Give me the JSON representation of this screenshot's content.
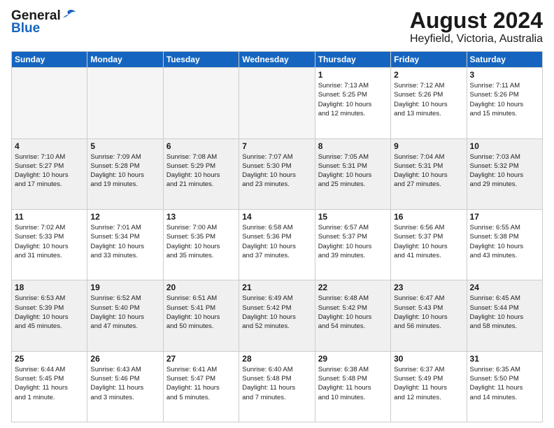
{
  "logo": {
    "general": "General",
    "blue": "Blue"
  },
  "title": "August 2024",
  "subtitle": "Heyfield, Victoria, Australia",
  "days_header": [
    "Sunday",
    "Monday",
    "Tuesday",
    "Wednesday",
    "Thursday",
    "Friday",
    "Saturday"
  ],
  "weeks": [
    [
      {
        "day": "",
        "info": ""
      },
      {
        "day": "",
        "info": ""
      },
      {
        "day": "",
        "info": ""
      },
      {
        "day": "",
        "info": ""
      },
      {
        "day": "1",
        "info": "Sunrise: 7:13 AM\nSunset: 5:25 PM\nDaylight: 10 hours\nand 12 minutes."
      },
      {
        "day": "2",
        "info": "Sunrise: 7:12 AM\nSunset: 5:26 PM\nDaylight: 10 hours\nand 13 minutes."
      },
      {
        "day": "3",
        "info": "Sunrise: 7:11 AM\nSunset: 5:26 PM\nDaylight: 10 hours\nand 15 minutes."
      }
    ],
    [
      {
        "day": "4",
        "info": "Sunrise: 7:10 AM\nSunset: 5:27 PM\nDaylight: 10 hours\nand 17 minutes."
      },
      {
        "day": "5",
        "info": "Sunrise: 7:09 AM\nSunset: 5:28 PM\nDaylight: 10 hours\nand 19 minutes."
      },
      {
        "day": "6",
        "info": "Sunrise: 7:08 AM\nSunset: 5:29 PM\nDaylight: 10 hours\nand 21 minutes."
      },
      {
        "day": "7",
        "info": "Sunrise: 7:07 AM\nSunset: 5:30 PM\nDaylight: 10 hours\nand 23 minutes."
      },
      {
        "day": "8",
        "info": "Sunrise: 7:05 AM\nSunset: 5:31 PM\nDaylight: 10 hours\nand 25 minutes."
      },
      {
        "day": "9",
        "info": "Sunrise: 7:04 AM\nSunset: 5:31 PM\nDaylight: 10 hours\nand 27 minutes."
      },
      {
        "day": "10",
        "info": "Sunrise: 7:03 AM\nSunset: 5:32 PM\nDaylight: 10 hours\nand 29 minutes."
      }
    ],
    [
      {
        "day": "11",
        "info": "Sunrise: 7:02 AM\nSunset: 5:33 PM\nDaylight: 10 hours\nand 31 minutes."
      },
      {
        "day": "12",
        "info": "Sunrise: 7:01 AM\nSunset: 5:34 PM\nDaylight: 10 hours\nand 33 minutes."
      },
      {
        "day": "13",
        "info": "Sunrise: 7:00 AM\nSunset: 5:35 PM\nDaylight: 10 hours\nand 35 minutes."
      },
      {
        "day": "14",
        "info": "Sunrise: 6:58 AM\nSunset: 5:36 PM\nDaylight: 10 hours\nand 37 minutes."
      },
      {
        "day": "15",
        "info": "Sunrise: 6:57 AM\nSunset: 5:37 PM\nDaylight: 10 hours\nand 39 minutes."
      },
      {
        "day": "16",
        "info": "Sunrise: 6:56 AM\nSunset: 5:37 PM\nDaylight: 10 hours\nand 41 minutes."
      },
      {
        "day": "17",
        "info": "Sunrise: 6:55 AM\nSunset: 5:38 PM\nDaylight: 10 hours\nand 43 minutes."
      }
    ],
    [
      {
        "day": "18",
        "info": "Sunrise: 6:53 AM\nSunset: 5:39 PM\nDaylight: 10 hours\nand 45 minutes."
      },
      {
        "day": "19",
        "info": "Sunrise: 6:52 AM\nSunset: 5:40 PM\nDaylight: 10 hours\nand 47 minutes."
      },
      {
        "day": "20",
        "info": "Sunrise: 6:51 AM\nSunset: 5:41 PM\nDaylight: 10 hours\nand 50 minutes."
      },
      {
        "day": "21",
        "info": "Sunrise: 6:49 AM\nSunset: 5:42 PM\nDaylight: 10 hours\nand 52 minutes."
      },
      {
        "day": "22",
        "info": "Sunrise: 6:48 AM\nSunset: 5:42 PM\nDaylight: 10 hours\nand 54 minutes."
      },
      {
        "day": "23",
        "info": "Sunrise: 6:47 AM\nSunset: 5:43 PM\nDaylight: 10 hours\nand 56 minutes."
      },
      {
        "day": "24",
        "info": "Sunrise: 6:45 AM\nSunset: 5:44 PM\nDaylight: 10 hours\nand 58 minutes."
      }
    ],
    [
      {
        "day": "25",
        "info": "Sunrise: 6:44 AM\nSunset: 5:45 PM\nDaylight: 11 hours\nand 1 minute."
      },
      {
        "day": "26",
        "info": "Sunrise: 6:43 AM\nSunset: 5:46 PM\nDaylight: 11 hours\nand 3 minutes."
      },
      {
        "day": "27",
        "info": "Sunrise: 6:41 AM\nSunset: 5:47 PM\nDaylight: 11 hours\nand 5 minutes."
      },
      {
        "day": "28",
        "info": "Sunrise: 6:40 AM\nSunset: 5:48 PM\nDaylight: 11 hours\nand 7 minutes."
      },
      {
        "day": "29",
        "info": "Sunrise: 6:38 AM\nSunset: 5:48 PM\nDaylight: 11 hours\nand 10 minutes."
      },
      {
        "day": "30",
        "info": "Sunrise: 6:37 AM\nSunset: 5:49 PM\nDaylight: 11 hours\nand 12 minutes."
      },
      {
        "day": "31",
        "info": "Sunrise: 6:35 AM\nSunset: 5:50 PM\nDaylight: 11 hours\nand 14 minutes."
      }
    ]
  ]
}
